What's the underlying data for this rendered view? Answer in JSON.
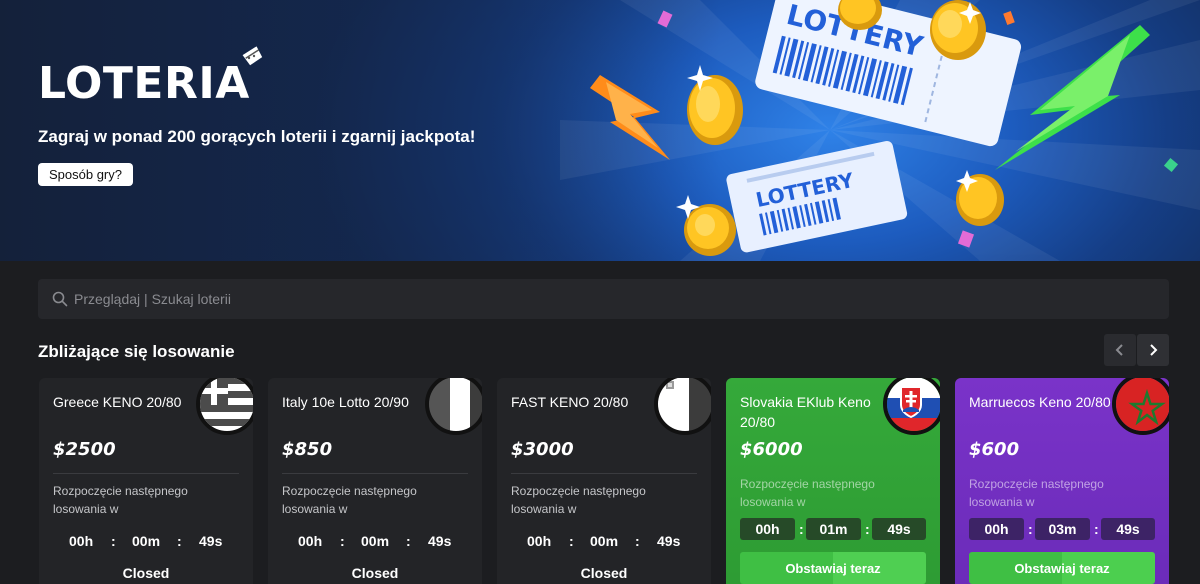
{
  "hero": {
    "title": "LOTERIA",
    "subtitle": "Zagraj w ponad 200 gorących loterii i zgarnij jackpota!",
    "howto_label": "Sposób gry?",
    "ticket_text": "LOTTERY"
  },
  "search": {
    "placeholder": "Przeglądaj | Szukaj loterii"
  },
  "section": {
    "title": "Zbliżające się losowanie"
  },
  "cards": [
    {
      "name": "Greece KENO 20/80",
      "prize": "$2500",
      "next_label": "Rozpoczęcie następnego losowania w",
      "hours": "00h",
      "minutes": "00m",
      "seconds": "49s",
      "status": "Closed",
      "flag": "greece-flag",
      "theme": "dark"
    },
    {
      "name": "Italy 10e Lotto 20/90",
      "prize": "$850",
      "next_label": "Rozpoczęcie następnego losowania w",
      "hours": "00h",
      "minutes": "00m",
      "seconds": "49s",
      "status": "Closed",
      "flag": "italy-flag",
      "theme": "dark"
    },
    {
      "name": "FAST KENO 20/80",
      "prize": "$3000",
      "next_label": "Rozpoczęcie następnego losowania w",
      "hours": "00h",
      "minutes": "00m",
      "seconds": "49s",
      "status": "Closed",
      "flag": "malta-flag",
      "theme": "dark"
    },
    {
      "name": "Slovakia EKlub Keno 20/80",
      "prize": "$6000",
      "next_label": "Rozpoczęcie następnego losowania w",
      "hours": "00h",
      "minutes": "01m",
      "seconds": "49s",
      "bet_label": "Obstawiaj teraz",
      "flag": "slovakia-flag",
      "theme": "green"
    },
    {
      "name": "Marruecos Keno 20/80",
      "prize": "$600",
      "next_label": "Rozpoczęcie następnego losowania w",
      "hours": "00h",
      "minutes": "03m",
      "seconds": "49s",
      "bet_label": "Obstawiaj teraz",
      "flag": "morocco-flag",
      "theme": "purple"
    }
  ],
  "colors": {
    "accent_green": "#3fbf44",
    "card_green": "#35a93a",
    "card_purple": "#7a33c9",
    "background": "#1c1d20"
  }
}
